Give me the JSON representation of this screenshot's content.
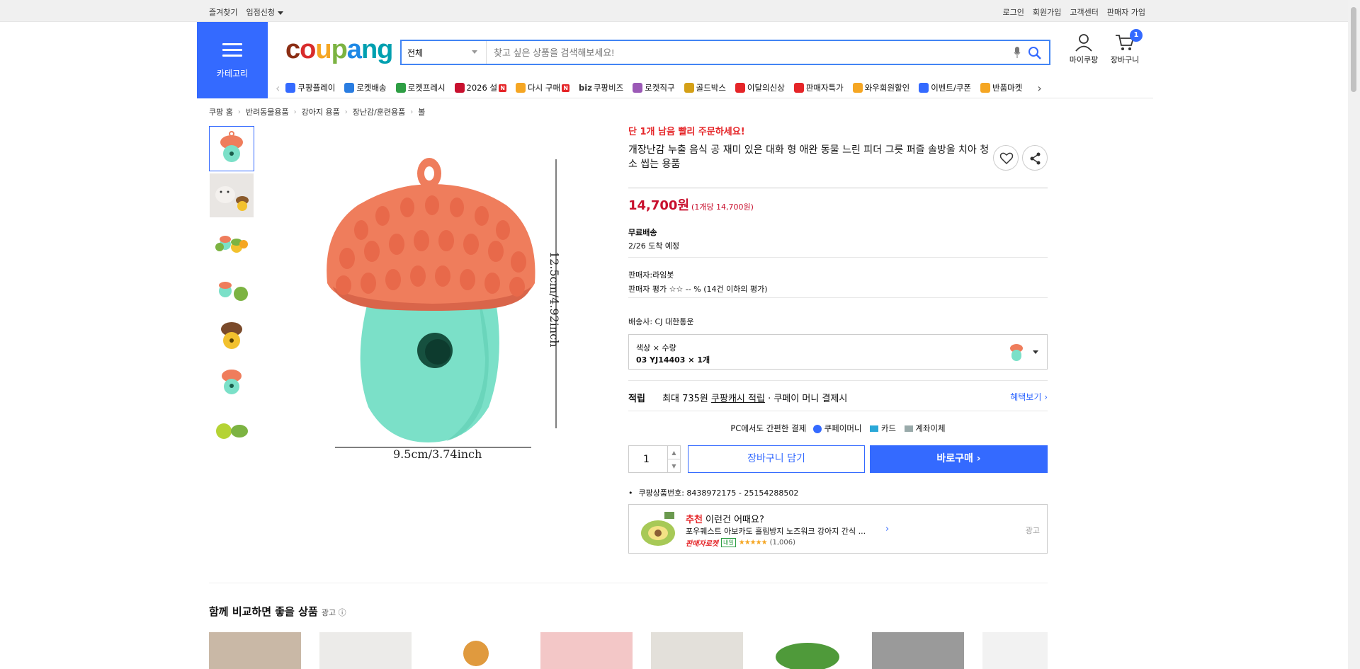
{
  "topbar": {
    "bookmark": "즐겨찾기",
    "seller_apply": "입점신청",
    "login": "로그인",
    "signup": "회원가입",
    "cs": "고객센터",
    "seller_signup": "판매자 가입"
  },
  "header": {
    "category_label": "카테고리",
    "logo": {
      "c1": "c",
      "c2": "o",
      "c3": "u",
      "c4": "p",
      "c5": "a",
      "c6": "ng"
    },
    "search_category": "전체",
    "search_placeholder": "찾고 싶은 상품을 검색해보세요!",
    "my_coupang": "마이쿠팡",
    "cart_label": "장바구니",
    "cart_count": "1"
  },
  "nav_items": [
    {
      "label": "쿠팡플레이",
      "color": "#346aff"
    },
    {
      "label": "로켓배송",
      "color": "#2a7de1"
    },
    {
      "label": "로켓프레시",
      "color": "#2e9e44"
    },
    {
      "label": "2026 설",
      "color": "#c8102e",
      "new": "N"
    },
    {
      "label": "다시 구매",
      "color": "#f5a623",
      "new": "N"
    },
    {
      "label": "쿠팡비즈",
      "prefix": "biz",
      "color": "#333333"
    },
    {
      "label": "로켓직구",
      "color": "#9b59b6"
    },
    {
      "label": "골드박스",
      "color": "#d4a017"
    },
    {
      "label": "이달의신상",
      "color": "#e52528"
    },
    {
      "label": "판매자특가",
      "color": "#e52528"
    },
    {
      "label": "와우회원할인",
      "color": "#f5a623"
    },
    {
      "label": "이벤트/쿠폰",
      "color": "#346aff"
    },
    {
      "label": "반품마켓",
      "color": "#f5a623"
    }
  ],
  "breadcrumb": [
    "쿠팡 홈",
    "반려동물용품",
    "강아지 용품",
    "장난감/훈련용품",
    "볼"
  ],
  "product": {
    "urgent": "단 1개 남음 빨리 주문하세요!",
    "title": "개장난감 누출 음식 공 재미 있은 대화 형 애완 동물 느린 피더 그릇 퍼즐 솔방울 치아 청소 씹는 용품",
    "price": "14,700원",
    "unit_price": "(1개당 14,700원)",
    "shipping_label": "무료배송",
    "arrival": "2/26 도착 예정",
    "seller": "판매자:라임봇",
    "seller_rating": "판매자 평가 ☆☆ -- % (14건 이하의 평가)",
    "carrier": "배송사:  CJ 대한통운",
    "option_label": "색상 × 수량",
    "option_value": "03 YJ14403 × 1개",
    "reward_key": "적립",
    "reward_text": "최대 735원",
    "reward_link_text": "쿠팡캐시 적립",
    "reward_suffix": "· 쿠페이 머니 결제시",
    "benefit_link": "혜택보기 ›",
    "pay_text": "PC에서도 간편한 결제",
    "pay_money": "쿠페이머니",
    "pay_card": "카드",
    "pay_bank": "계좌이체",
    "qty": "1",
    "cart_button": "장바구니 담기",
    "buy_button": "바로구매 ›",
    "product_id": "쿠팡상품번호: 8438972175 - 25154288502"
  },
  "image_text": {
    "height_dim": "12.5cm/4.92inch",
    "width_dim": "9.5cm/3.74inch"
  },
  "recommend": {
    "red": "추천",
    "headline": " 이런건 어때요?",
    "name": "포우퀘스트 아보카도 흘림방지 노즈워크 강아지 간식 ...",
    "badge": "판매자로켓",
    "tag": "내일",
    "stars": "★★★★★",
    "reviews": "(1,006)",
    "ad": "광고"
  },
  "compare": {
    "title": "함께 비교하면 좋을 상품",
    "ad": "광고 ⓘ"
  },
  "colors": {
    "accent": "#346aff",
    "price": "#c8102e",
    "acorn_cap": "#ef7d5c",
    "acorn_body": "#7be0c8"
  }
}
